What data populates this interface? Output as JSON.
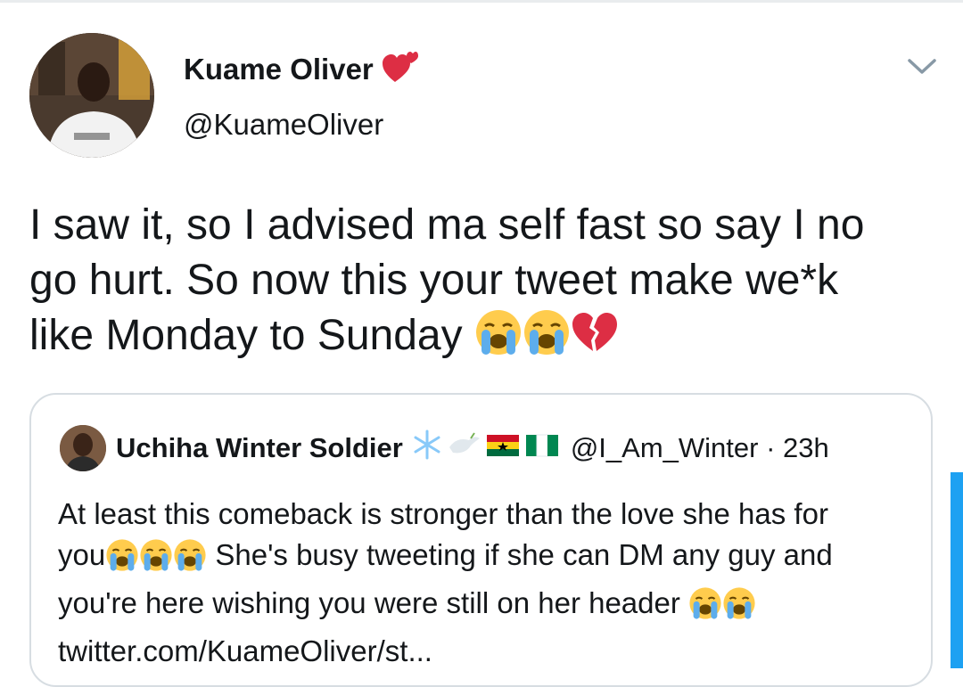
{
  "tweet": {
    "author": {
      "name": "Kuame Oliver",
      "name_emoji": "two-hearts",
      "handle": "@KuameOliver"
    },
    "menu_icon": "chevron-down-icon",
    "text_line1": "I saw it, so I advised ma self fast so say I no",
    "text_line2": "go hurt. So now this your tweet make we*k",
    "text_line3": "like Monday to Sunday",
    "text_emojis": [
      "loudly-crying-face",
      "loudly-crying-face",
      "broken-heart"
    ]
  },
  "quoted_tweet": {
    "author": {
      "name": "Uchiha Winter Soldier",
      "name_emojis": [
        "snowflake",
        "dove",
        "ghana-flag",
        "nigeria-flag"
      ],
      "handle": "@I_Am_Winter",
      "separator": "·",
      "time": "23h"
    },
    "line1": "At least this comeback is stronger than the love she has for",
    "line2_a": "you",
    "line2_b": " She's busy tweeting if she can DM any guy and",
    "line3": "you're here wishing you were still on her header",
    "link": "twitter.com/KuameOliver/st..."
  },
  "colors": {
    "text": "#14171a",
    "border": "#d7dde2",
    "accent": "#1da1f2",
    "emoji_face": "#ffcc4d",
    "emoji_tear": "#5dadec",
    "heart_red": "#dd2e44"
  }
}
